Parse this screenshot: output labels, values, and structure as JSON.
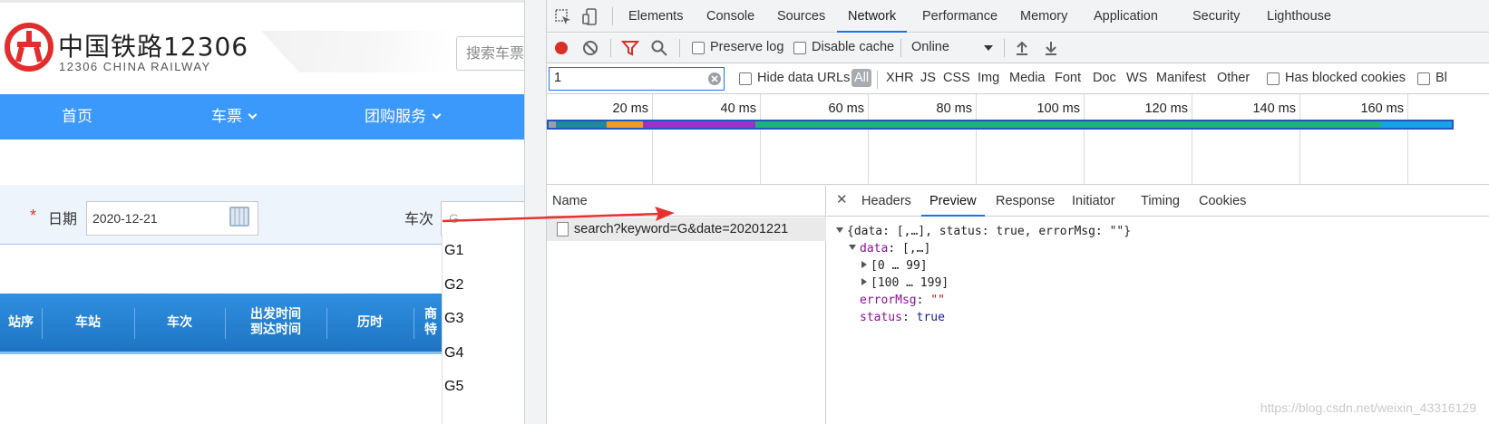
{
  "site": {
    "brand_cn": "中国铁路12306",
    "brand_en": "12306 CHINA RAILWAY",
    "search_placeholder": "搜索车票",
    "nav": [
      {
        "label": "首页",
        "has_menu": false
      },
      {
        "label": "车票",
        "has_menu": true
      },
      {
        "label": "团购服务",
        "has_menu": true
      }
    ],
    "form": {
      "required_mark": "*",
      "date_label": "日期",
      "date_value": "2020-12-21",
      "train_label": "车次",
      "train_value": "G"
    },
    "suggestions": [
      "G1",
      "G2",
      "G3",
      "G4",
      "G5"
    ],
    "table_headers": [
      "站序",
      "车站",
      "车次",
      "出发时间",
      "到达时间",
      "历时",
      "商",
      "特"
    ]
  },
  "devtools": {
    "tabs": [
      "Elements",
      "Console",
      "Sources",
      "Network",
      "Performance",
      "Memory",
      "Application",
      "Security",
      "Lighthouse"
    ],
    "active_tab": "Network",
    "toolbar": {
      "preserve_log": "Preserve log",
      "disable_cache": "Disable cache",
      "throttle": "Online"
    },
    "filter": {
      "value": "1",
      "hide_data_urls": "Hide data URLs",
      "types": [
        "All",
        "XHR",
        "JS",
        "CSS",
        "Img",
        "Media",
        "Font",
        "Doc",
        "WS",
        "Manifest",
        "Other"
      ],
      "blocked_cookies": "Has blocked cookies",
      "blocked_truncated": "Bl"
    },
    "timeline_ticks": [
      "20 ms",
      "40 ms",
      "60 ms",
      "80 ms",
      "100 ms",
      "120 ms",
      "140 ms",
      "160 ms"
    ],
    "colors": {
      "accent": "#1a73e8",
      "record": "#d93025",
      "nav_blue": "#3b99fc"
    },
    "name_header": "Name",
    "request_name": "search?keyword=G&date=20201221",
    "detail_tabs": [
      "Headers",
      "Preview",
      "Response",
      "Initiator",
      "Timing",
      "Cookies"
    ],
    "active_detail_tab": "Preview",
    "preview": {
      "root": "{data: [,…], status: true, errorMsg: \"\"}",
      "data_key": "data",
      "data_summary": "[,…]",
      "range_1": "[0 … 99]",
      "range_2": "[100 … 199]",
      "error_key": "errorMsg",
      "error_val": "\"\"",
      "status_key": "status",
      "status_val": "true"
    }
  },
  "watermark": "https://blog.csdn.net/weixin_43316129"
}
